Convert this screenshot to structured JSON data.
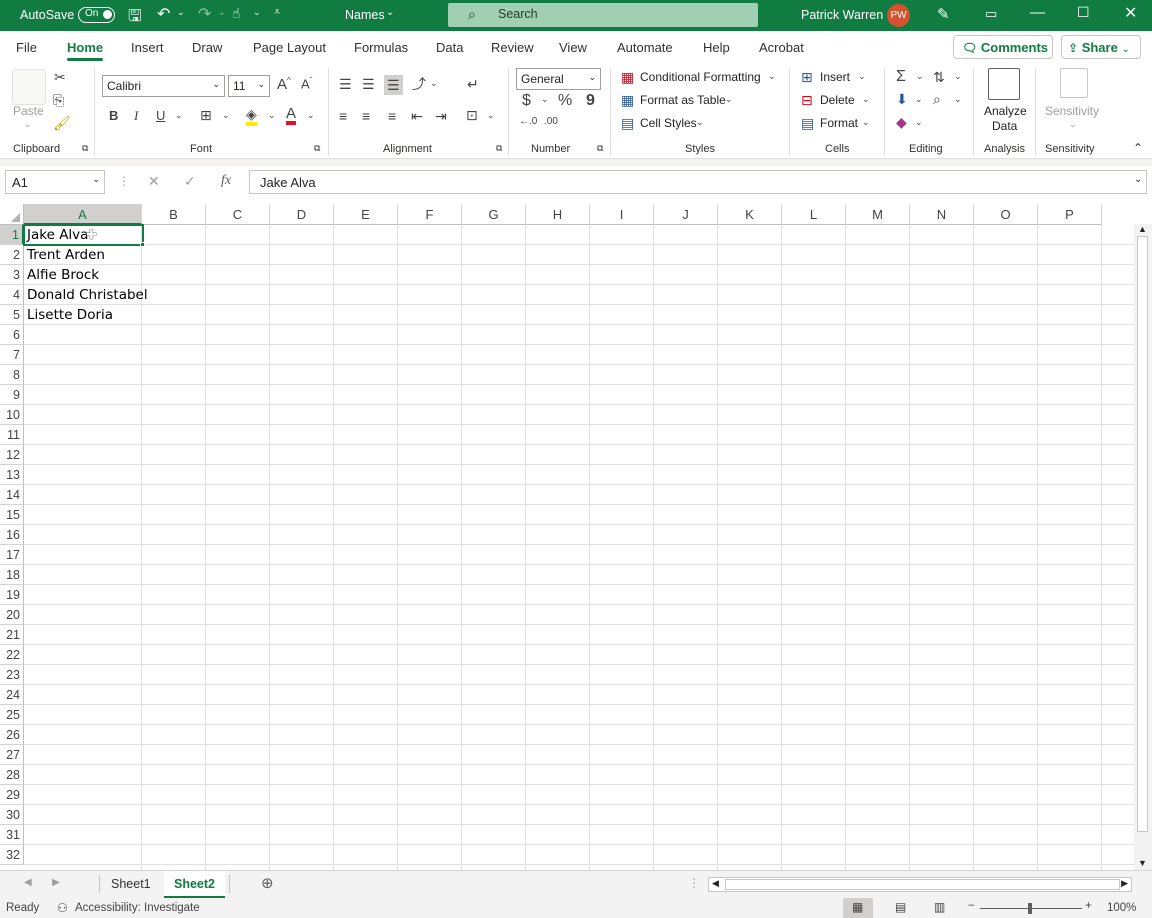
{
  "titlebar": {
    "autosave_label": "AutoSave",
    "autosave_state": "On",
    "doc_name": "Names",
    "search_placeholder": "Search",
    "user_name": "Patrick Warren",
    "user_initials": "PW",
    "accent": "#107c41"
  },
  "menu": {
    "tabs": [
      "File",
      "Home",
      "Insert",
      "Draw",
      "Page Layout",
      "Formulas",
      "Data",
      "Review",
      "View",
      "Automate",
      "Help",
      "Acrobat"
    ],
    "active": "Home",
    "comments_label": "Comments",
    "share_label": "Share"
  },
  "ribbon": {
    "clipboard": {
      "paste": "Paste",
      "group": "Clipboard"
    },
    "font": {
      "name": "Calibri",
      "size": "11",
      "bold": "B",
      "italic": "I",
      "underline": "U",
      "group": "Font"
    },
    "alignment": {
      "group": "Alignment"
    },
    "number": {
      "format": "General",
      "currency": "$",
      "percent": "%",
      "comma": "9",
      "inc_dec": "←.0\n.00",
      "dec_dec": ".00\n→.0",
      "group": "Number"
    },
    "styles": {
      "conditional": "Conditional Formatting",
      "format_table": "Format as Table",
      "cell_styles": "Cell Styles",
      "group": "Styles"
    },
    "cells": {
      "insert": "Insert",
      "delete": "Delete",
      "format": "Format",
      "group": "Cells"
    },
    "editing": {
      "group": "Editing"
    },
    "analysis": {
      "analyze1": "Analyze",
      "analyze2": "Data",
      "group": "Analysis"
    },
    "sensitivity": {
      "label": "Sensitivity",
      "group": "Sensitivity"
    }
  },
  "formula_bar": {
    "name_box": "A1",
    "fx": "fx",
    "content": "Jake Alva"
  },
  "grid": {
    "columns": [
      "A",
      "B",
      "C",
      "D",
      "E",
      "F",
      "G",
      "H",
      "I",
      "J",
      "K",
      "L",
      "M",
      "N",
      "O",
      "P"
    ],
    "rows": [
      "1",
      "2",
      "3",
      "4",
      "5",
      "6",
      "7",
      "8",
      "9",
      "10",
      "11",
      "12",
      "13",
      "14",
      "15",
      "16",
      "17",
      "18",
      "19",
      "20",
      "21",
      "22",
      "23",
      "24",
      "25",
      "26",
      "27",
      "28",
      "29",
      "30",
      "31",
      "32"
    ],
    "cells": [
      "Jake Alva",
      "Trent Arden",
      "Alfie Brock",
      "Donald Christabel",
      "Lisette Doria"
    ]
  },
  "sheets": {
    "tabs": [
      "Sheet1",
      "Sheet2"
    ],
    "active": "Sheet2"
  },
  "status": {
    "ready": "Ready",
    "accessibility": "Accessibility: Investigate",
    "zoom": "100%"
  }
}
